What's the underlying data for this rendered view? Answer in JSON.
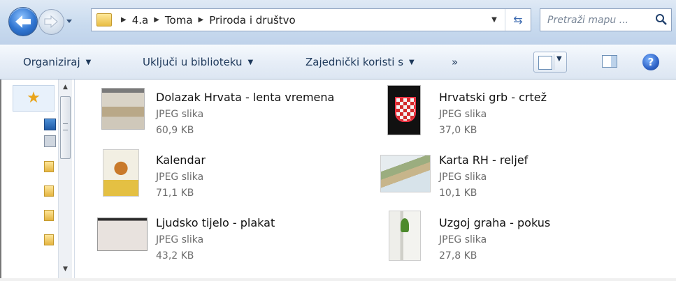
{
  "address": {
    "crumbs": [
      "4.a",
      "Toma",
      "Priroda i društvo"
    ],
    "search_placeholder": "Pretraži mapu ..."
  },
  "toolbar": {
    "organize": "Organiziraj",
    "include_library": "Uključi u biblioteku",
    "share_with": "Zajednički koristi s",
    "more": "»"
  },
  "icons": {
    "back": "back-arrow-icon",
    "forward": "forward-arrow-icon",
    "refresh": "refresh-icon",
    "search": "magnifier-icon",
    "help": "help-icon",
    "favorites": "star-icon"
  },
  "colors": {
    "toolbar_text": "#1e395b",
    "secondary_text": "#6d6d6d",
    "favorites_star": "#e9a41a"
  },
  "files": [
    {
      "name": "Dolazak Hrvata - lenta vremena",
      "type": "JPEG slika",
      "size": "60,9 KB"
    },
    {
      "name": "Hrvatski grb - crtež",
      "type": "JPEG slika",
      "size": "37,0 KB"
    },
    {
      "name": "Kalendar",
      "type": "JPEG slika",
      "size": "71,1 KB"
    },
    {
      "name": "Karta RH - reljef",
      "type": "JPEG slika",
      "size": "10,1 KB"
    },
    {
      "name": "Ljudsko tijelo - plakat",
      "type": "JPEG slika",
      "size": "43,2 KB"
    },
    {
      "name": "Uzgoj graha - pokus",
      "type": "JPEG slika",
      "size": "27,8 KB"
    }
  ]
}
